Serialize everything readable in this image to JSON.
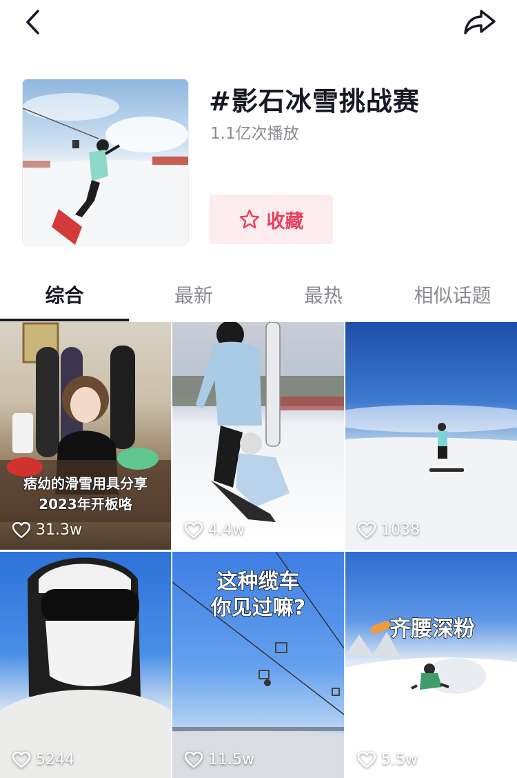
{
  "header": {
    "title": "#影石冰雪挑战赛",
    "play_count": "1.1亿次播放",
    "favorite_label": "收藏"
  },
  "tabs": [
    {
      "label": "综合",
      "active": true
    },
    {
      "label": "最新",
      "active": false
    },
    {
      "label": "最热",
      "active": false
    },
    {
      "label": "相似话题",
      "active": false
    }
  ],
  "videos": [
    {
      "caption": "痞幼的滑雪用具分享",
      "caption2": "2023年开板咯",
      "likes": "31.3w"
    },
    {
      "caption": "",
      "caption2": "",
      "likes": "4.4w"
    },
    {
      "caption": "",
      "caption2": "",
      "likes": "1038"
    },
    {
      "caption": "",
      "caption2": "",
      "likes": "5244"
    },
    {
      "caption": "这种缆车",
      "caption2": "你见过嘛?",
      "likes": "11.5w"
    },
    {
      "caption": "齐腰深粉",
      "caption2": "",
      "likes": "5.5w"
    }
  ],
  "colors": {
    "accent": "#e63e5c",
    "accent_bg": "#fdecee",
    "text_primary": "#161823",
    "text_secondary": "#8a8b91"
  },
  "icons": {
    "back": "chevron-left-icon",
    "share": "share-arrow-icon",
    "favorite": "star-outline-icon",
    "like": "heart-outline-icon"
  }
}
